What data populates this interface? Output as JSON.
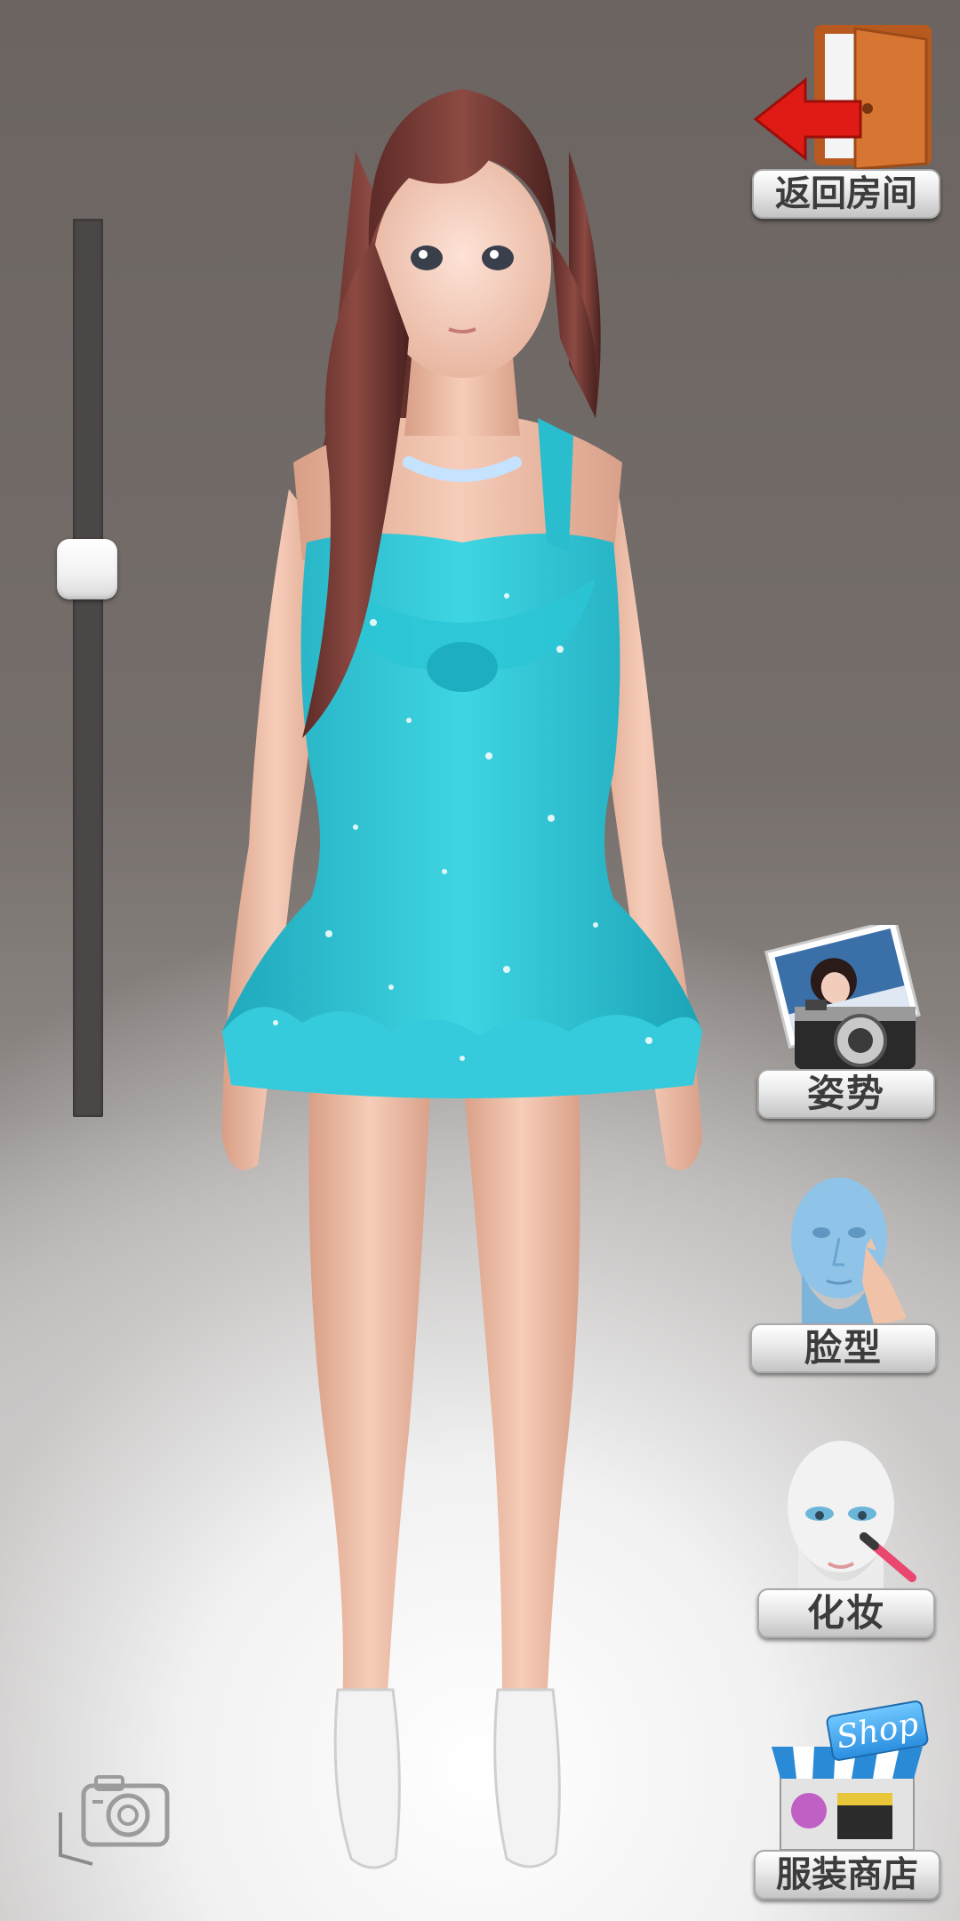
{
  "zoom_slider": {
    "level": 0.39
  },
  "buttons": {
    "back": {
      "label": "返回房间",
      "icon": "door-exit-icon"
    },
    "pose": {
      "label": "姿势",
      "icon": "camera-photo-icon"
    },
    "face": {
      "label": "脸型",
      "icon": "face-shape-icon"
    },
    "makeup": {
      "label": "化妆",
      "icon": "makeup-brush-icon"
    },
    "shop": {
      "label": "服装商店",
      "icon": "shop-store-icon",
      "sign": "Shop"
    }
  },
  "camera": {
    "icon": "screenshot-camera-icon"
  },
  "colors": {
    "dress": "#2bc6d6",
    "hair": "#7a3b34",
    "skin": "#f2c3ae",
    "door": "#d0692a",
    "arrow": "#e01b16"
  }
}
